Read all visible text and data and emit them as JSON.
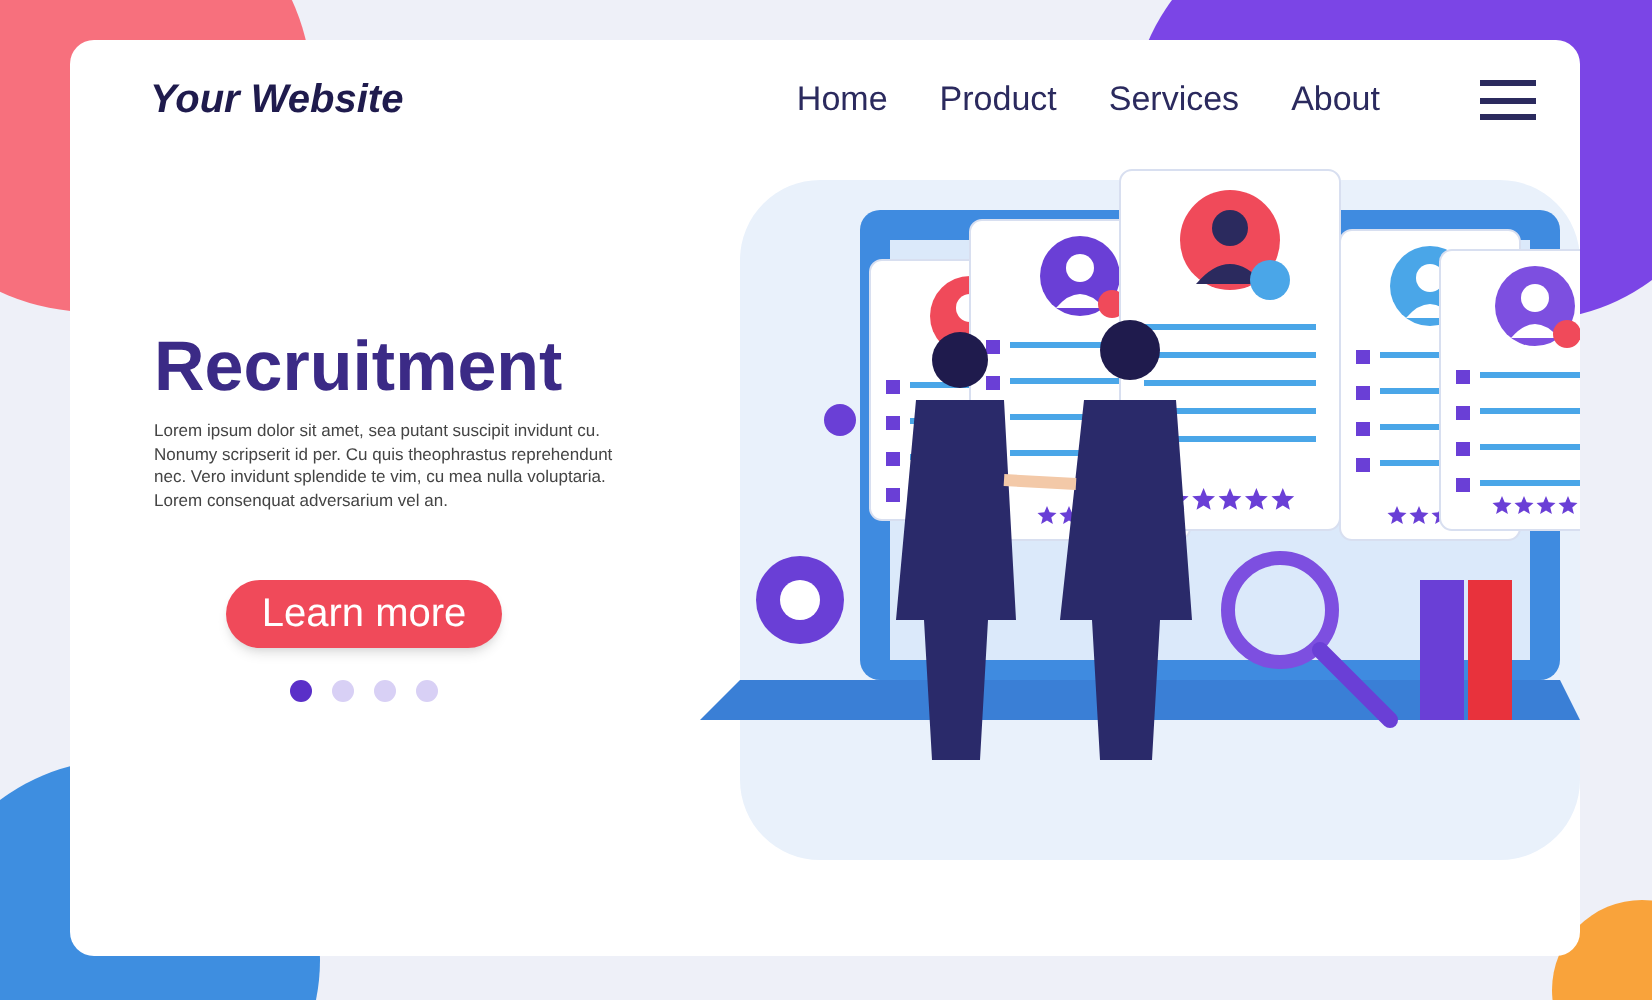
{
  "header": {
    "logo": "Your Website",
    "nav": [
      {
        "label": "Home"
      },
      {
        "label": "Product"
      },
      {
        "label": "Services"
      },
      {
        "label": "About"
      }
    ]
  },
  "hero": {
    "title": "Recruitment",
    "body": "Lorem ipsum dolor sit amet, sea putant suscipit invidunt cu. Nonumy scripserit id per. Cu quis theophrastus reprehendunt nec. Vero invidunt splendide te vim, cu mea nulla voluptaria. Lorem consenquat adversarium vel an.",
    "button": "Learn more",
    "dots": [
      {
        "selected": true
      },
      {
        "selected": false
      },
      {
        "selected": false
      },
      {
        "selected": false
      }
    ]
  }
}
